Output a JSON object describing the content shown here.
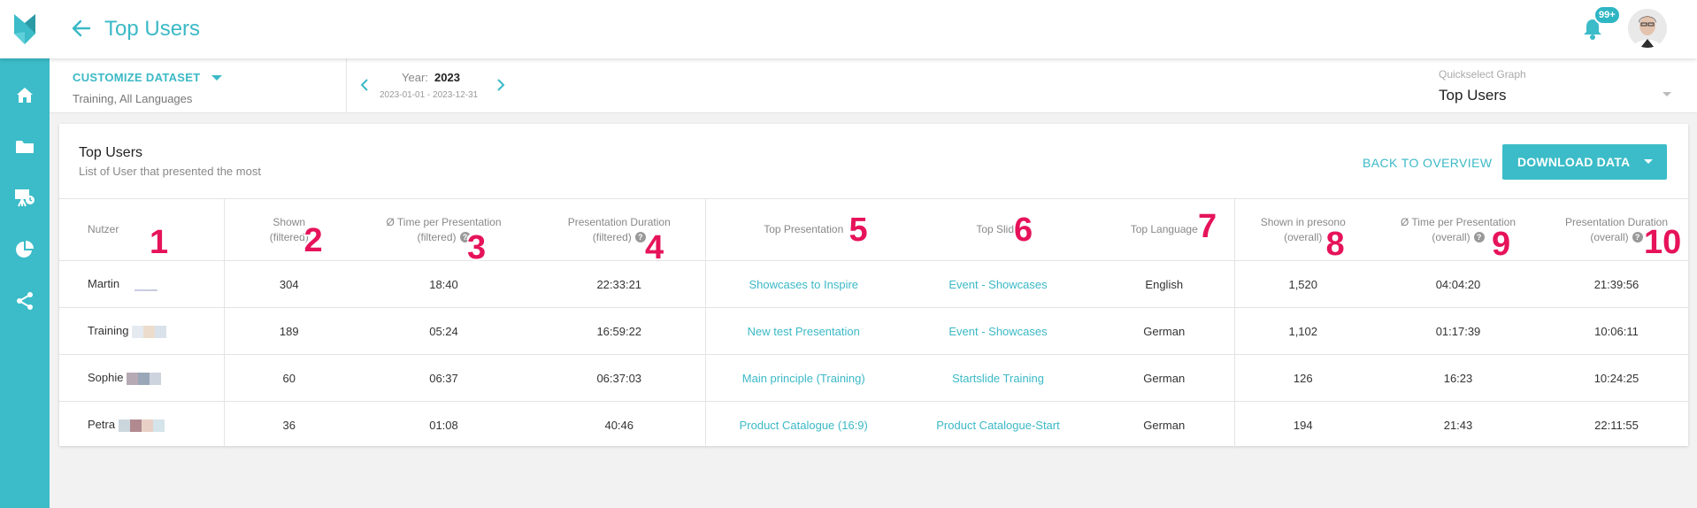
{
  "header": {
    "title": "Top Users",
    "notification_count": "99+"
  },
  "sidebar": {
    "items": [
      "home-icon",
      "folder-icon",
      "presentation-icon",
      "pie-chart-icon",
      "share-icon"
    ]
  },
  "filterbar": {
    "customize_label": "CUSTOMIZE DATASET",
    "dataset_summary": "Training, All Languages",
    "year_label": "Year:",
    "year_value": "2023",
    "year_range": "2023-01-01 - 2023-12-31",
    "quickselect_label": "Quickselect Graph",
    "quickselect_value": "Top Users"
  },
  "card": {
    "title": "Top Users",
    "subtitle": "List of User that presented the most",
    "back_label": "BACK TO OVERVIEW",
    "download_label": "DOWNLOAD DATA"
  },
  "table": {
    "columns": [
      {
        "line1": "Nutzer",
        "line2": "",
        "marker": "1"
      },
      {
        "line1": "Shown",
        "line2": "(filtered)",
        "marker": "2"
      },
      {
        "line1": "Ø Time per Presentation",
        "line2": "(filtered)",
        "marker": "3"
      },
      {
        "line1": "Presentation Duration",
        "line2": "(filtered)",
        "marker": "4"
      },
      {
        "line1": "Top Presentation",
        "line2": "",
        "marker": "5"
      },
      {
        "line1": "Top Slide",
        "line2": "",
        "marker": "6"
      },
      {
        "line1": "Top Language",
        "line2": "",
        "marker": "7"
      },
      {
        "line1": "Shown in presono",
        "line2": "(overall)",
        "marker": "8"
      },
      {
        "line1": "Ø Time per Presentation",
        "line2": "(overall)",
        "marker": "9"
      },
      {
        "line1": "Presentation Duration",
        "line2": "(overall)",
        "marker": "10"
      }
    ],
    "rows": [
      {
        "user": "Martin",
        "shown": "304",
        "avg_time": "18:40",
        "duration": "22:33:21",
        "top_presentation": "Showcases to Inspire",
        "top_slide": "Event - Showcases",
        "top_language": "English",
        "shown_overall": "1,520",
        "avg_time_overall": "04:04:20",
        "duration_overall": "21:39:56"
      },
      {
        "user": "Training",
        "shown": "189",
        "avg_time": "05:24",
        "duration": "16:59:22",
        "top_presentation": "New test Presentation",
        "top_slide": "Event - Showcases",
        "top_language": "German",
        "shown_overall": "1,102",
        "avg_time_overall": "01:17:39",
        "duration_overall": "10:06:11"
      },
      {
        "user": "Sophie",
        "shown": "60",
        "avg_time": "06:37",
        "duration": "06:37:03",
        "top_presentation": "Main principle (Training)",
        "top_slide": "Startslide Training",
        "top_language": "German",
        "shown_overall": "126",
        "avg_time_overall": "16:23",
        "duration_overall": "10:24:25"
      },
      {
        "user": "Petra",
        "shown": "36",
        "avg_time": "01:08",
        "duration": "40:46",
        "top_presentation": "Product Catalogue (16:9)",
        "top_slide": "Product Catalogue-Start",
        "top_language": "German",
        "shown_overall": "194",
        "avg_time_overall": "21:43",
        "duration_overall": "22:11:55"
      }
    ]
  },
  "colors": {
    "accent": "#3bbcc8",
    "marker": "#e6135a"
  }
}
